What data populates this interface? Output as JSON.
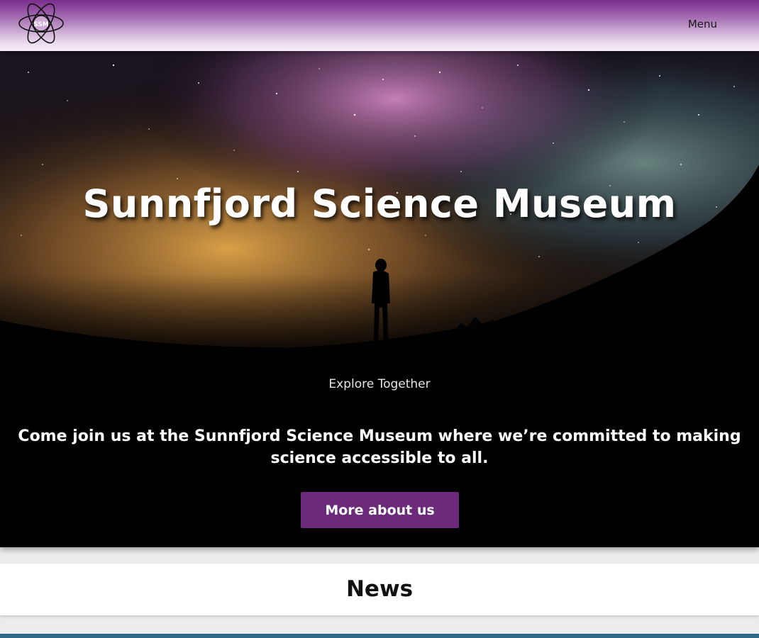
{
  "header": {
    "logo_text": "SSM",
    "menu_label": "Menu"
  },
  "hero": {
    "title": "Sunnfjord Science Museum",
    "tagline": "Explore Together",
    "intro": "Come join us at the Sunnfjord Science Museum where we’re committed to making science accessible to all.",
    "button_label": "More about us"
  },
  "news": {
    "title": "News"
  },
  "colors": {
    "brand_purple": "#6c2a7a",
    "header_top": "#7b2d8e",
    "footer_bar": "#2f6a86"
  }
}
